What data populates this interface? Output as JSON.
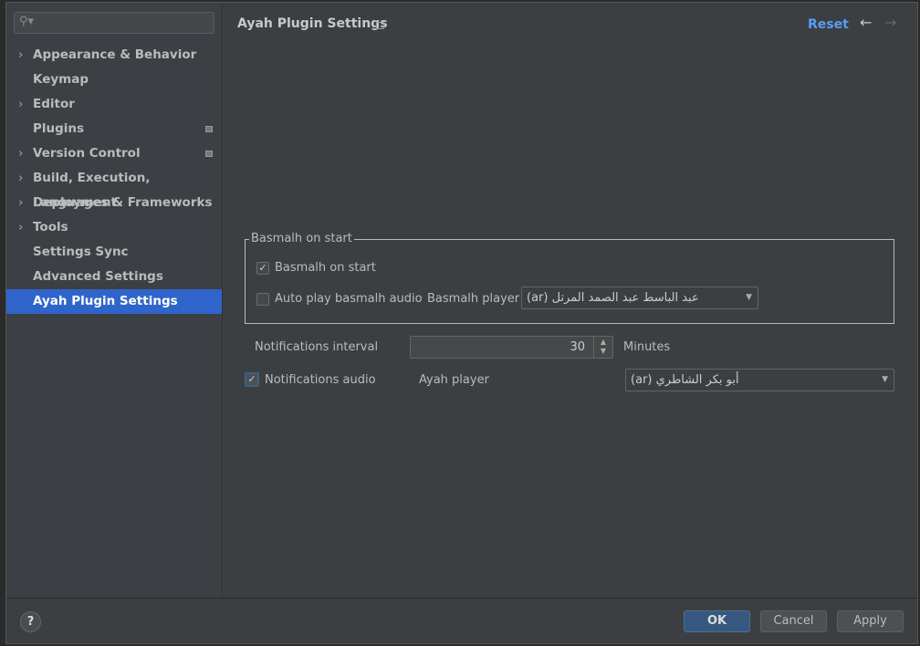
{
  "sidebar": {
    "search_placeholder": "",
    "items": [
      {
        "label": "Appearance & Behavior",
        "expandable": true
      },
      {
        "label": "Keymap"
      },
      {
        "label": "Editor",
        "expandable": true
      },
      {
        "label": "Plugins",
        "modified": true
      },
      {
        "label": "Version Control",
        "expandable": true,
        "modified": true
      },
      {
        "label": "Build, Execution, Deployment",
        "expandable": true
      },
      {
        "label": "Languages & Frameworks",
        "expandable": true
      },
      {
        "label": "Tools",
        "expandable": true
      },
      {
        "label": "Settings Sync"
      },
      {
        "label": "Advanced Settings"
      },
      {
        "label": "Ayah Plugin Settings",
        "selected": true
      }
    ]
  },
  "header": {
    "title": "Ayah Plugin Settings",
    "reset": "Reset"
  },
  "basmalh_group": {
    "title": "Basmalh on start",
    "basmalh_on_start": {
      "label": "Basmalh on start",
      "checked": true
    },
    "auto_play": {
      "label": "Auto play basmalh audio",
      "checked": false
    },
    "player_label": "Basmalh player",
    "player_value": "عبد الباسط عبد الصمد المرتل (ar)"
  },
  "notifications": {
    "interval_label": "Notifications interval",
    "interval_value": "30",
    "interval_unit": "Minutes",
    "audio": {
      "label": "Notifications audio",
      "checked": true
    },
    "ayah_player_label": "Ayah player",
    "ayah_player_value": "أبو بكر الشاطري (ar)"
  },
  "footer": {
    "help": "?",
    "ok": "OK",
    "cancel": "Cancel",
    "apply": "Apply"
  },
  "colors": {
    "accent": "#589df6",
    "selection": "#2f65ca"
  }
}
